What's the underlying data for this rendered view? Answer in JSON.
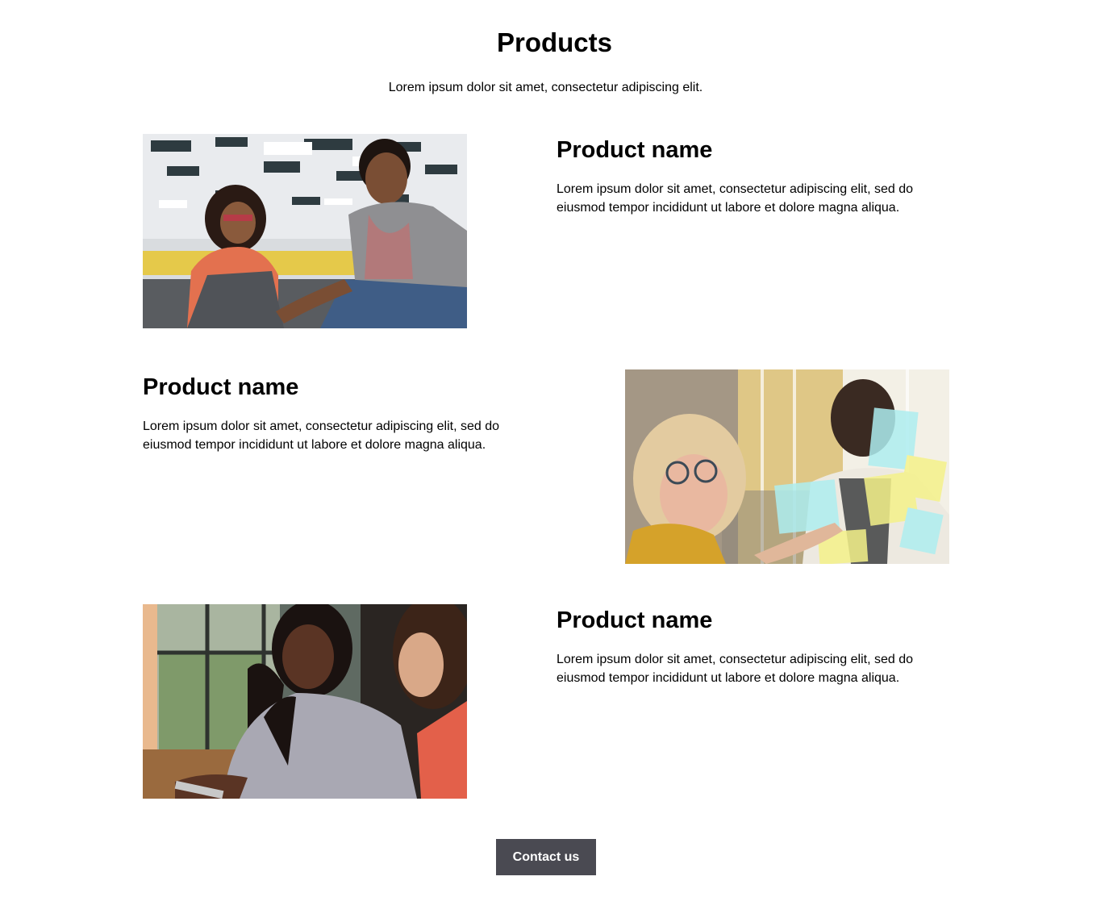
{
  "header": {
    "title": "Products",
    "subtitle": "Lorem ipsum dolor sit amet, consectetur adipiscing elit."
  },
  "products": [
    {
      "name": "Product name",
      "description": "Lorem ipsum dolor sit amet, consectetur adipiscing elit, sed do eiusmod tempor incididunt ut labore et dolore magna aliqua.",
      "image_alt": "Two colleagues smiling at a laptop in an office"
    },
    {
      "name": "Product name",
      "description": "Lorem ipsum dolor sit amet, consectetur adipiscing elit, sed do eiusmod tempor incididunt ut labore et dolore magna aliqua.",
      "image_alt": "Two colleagues placing sticky notes on a glass wall"
    },
    {
      "name": "Product name",
      "description": "Lorem ipsum dolor sit amet, consectetur adipiscing elit, sed do eiusmod tempor incididunt ut labore et dolore magna aliqua.",
      "image_alt": "Two women working together at a table"
    }
  ],
  "cta": {
    "label": "Contact us"
  }
}
